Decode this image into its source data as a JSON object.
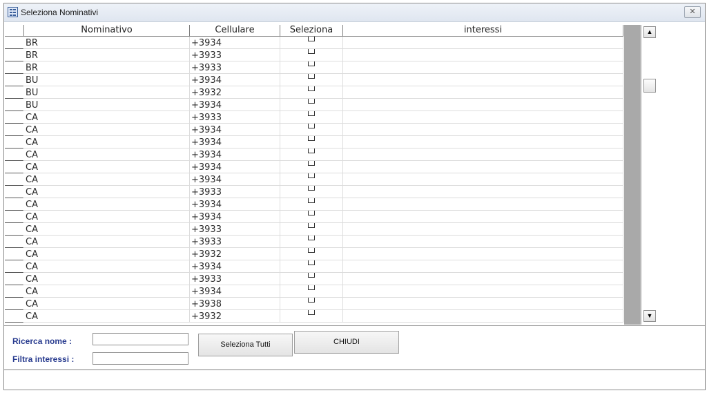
{
  "window": {
    "title": "Seleziona Nominativi",
    "close_glyph": "✕"
  },
  "grid": {
    "columns": [
      "Nominativo",
      "Cellulare",
      "Seleziona",
      "interessi"
    ],
    "rows": [
      {
        "nome": "BR",
        "cellulare": "+3934"
      },
      {
        "nome": "BR",
        "cellulare": "+3933"
      },
      {
        "nome": "BR",
        "cellulare": "+3933"
      },
      {
        "nome": "BU",
        "cellulare": "+3934"
      },
      {
        "nome": "BU",
        "cellulare": "+3932"
      },
      {
        "nome": "BU",
        "cellulare": "+3934"
      },
      {
        "nome": "CA",
        "cellulare": "+3933"
      },
      {
        "nome": "CA",
        "cellulare": "+3934"
      },
      {
        "nome": "CA",
        "cellulare": "+3934"
      },
      {
        "nome": "CA",
        "cellulare": "+3934"
      },
      {
        "nome": "CA",
        "cellulare": "+3934"
      },
      {
        "nome": "CA",
        "cellulare": "+3934"
      },
      {
        "nome": "CA",
        "cellulare": "+3933"
      },
      {
        "nome": "CA",
        "cellulare": "+3934"
      },
      {
        "nome": "CA",
        "cellulare": "+3934"
      },
      {
        "nome": "CA",
        "cellulare": "+3933"
      },
      {
        "nome": "CA",
        "cellulare": "+3933"
      },
      {
        "nome": "CA",
        "cellulare": "+3932"
      },
      {
        "nome": "CA",
        "cellulare": "+3934"
      },
      {
        "nome": "CA",
        "cellulare": "+3933"
      },
      {
        "nome": "CA",
        "cellulare": "+3934"
      },
      {
        "nome": "CA",
        "cellulare": "+3938"
      },
      {
        "nome": "CA",
        "cellulare": "+3932"
      }
    ]
  },
  "scrollbar": {
    "up_icon": "▲",
    "down_icon": "▼"
  },
  "form": {
    "ricerca_label": "Ricerca nome :",
    "ricerca_value": "",
    "filtra_label": "Filtra interessi :",
    "filtra_value": "",
    "seleziona_tutti_label": "Seleziona Tutti",
    "chiudi_label": "CHIUDI"
  }
}
